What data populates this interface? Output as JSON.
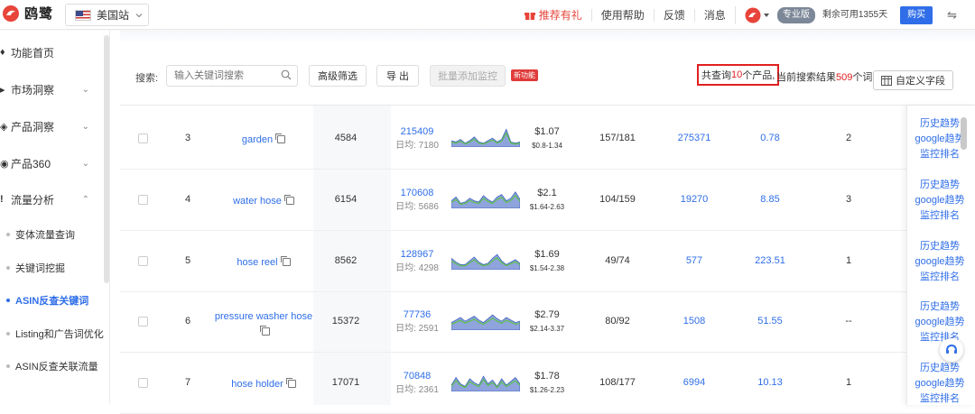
{
  "app": {
    "name": "鸥鹭",
    "site": "美国站"
  },
  "topbar": {
    "recommend": "推荐有礼",
    "help": "使用帮助",
    "feedback": "反馈",
    "message": "消息",
    "edition": "专业版",
    "remaining": "剩余可用1355天",
    "buy": "购买"
  },
  "sidebar": {
    "items": [
      {
        "label": "功能首页"
      },
      {
        "label": "市场洞察"
      },
      {
        "label": "产品洞察"
      },
      {
        "label": "产品360"
      },
      {
        "label": "流量分析"
      }
    ],
    "subitems": [
      {
        "label": "变体流量查询"
      },
      {
        "label": "关键词挖掘"
      },
      {
        "label": "ASIN反查关键词"
      },
      {
        "label": "Listing和广告词优化"
      },
      {
        "label": "ASIN反查关联流量"
      }
    ]
  },
  "toolbar": {
    "search_label": "搜索:",
    "search_placeholder": "输入关键词搜索",
    "advanced": "高级筛选",
    "export": "导 出",
    "batch_monitor": "批量添加监控",
    "new_tag": "新功能",
    "count_prefix": "共查询",
    "count_value": "10",
    "count_suffix": "个产品,",
    "result_prefix": "当前搜索结果",
    "result_value": "509",
    "result_suffix": "个词",
    "custom_fields": "自定义字段"
  },
  "rows": [
    {
      "idx": "3",
      "keyword": "garden",
      "c3": "4584",
      "search": "215409",
      "avg": "日均: 7180",
      "price": "$1.07",
      "range": "$0.8-1.34",
      "ratio": "157/181",
      "c7": "275371",
      "c8": "0.78",
      "c9": "2"
    },
    {
      "idx": "4",
      "keyword": "water hose",
      "c3": "6154",
      "search": "170608",
      "avg": "日均: 5686",
      "price": "$2.1",
      "range": "$1.64-2.63",
      "ratio": "104/159",
      "c7": "19270",
      "c8": "8.85",
      "c9": "3"
    },
    {
      "idx": "5",
      "keyword": "hose reel",
      "c3": "8562",
      "search": "128967",
      "avg": "日均: 4298",
      "price": "$1.69",
      "range": "$1.54-2.38",
      "ratio": "49/74",
      "c7": "577",
      "c8": "223.51",
      "c9": "1"
    },
    {
      "idx": "6",
      "keyword": "pressure washer hose",
      "c3": "15372",
      "search": "77736",
      "avg": "日均: 2591",
      "price": "$2.79",
      "range": "$2.14-3.37",
      "ratio": "80/92",
      "c7": "1508",
      "c8": "51.55",
      "c9": "--"
    },
    {
      "idx": "7",
      "keyword": "hose holder",
      "c3": "17071",
      "search": "70848",
      "avg": "日均: 2361",
      "price": "$1.78",
      "range": "$1.26-2.23",
      "ratio": "108/177",
      "c7": "6994",
      "c8": "10.13",
      "c9": "1"
    }
  ],
  "actions": {
    "history": "历史趋势",
    "google": "google趋势",
    "monitor": "监控排名"
  },
  "colors": {
    "accent": "#2f6ee8",
    "red": "#e02020",
    "spark_fill": "#8fa3dc",
    "spark_line": "#5cc24a"
  },
  "icons": [
    "logo-icon",
    "us-flag-icon",
    "chevron-down-icon",
    "gift-icon",
    "search-icon",
    "columns-icon",
    "copy-icon",
    "chat-icon",
    "logout-icon"
  ]
}
